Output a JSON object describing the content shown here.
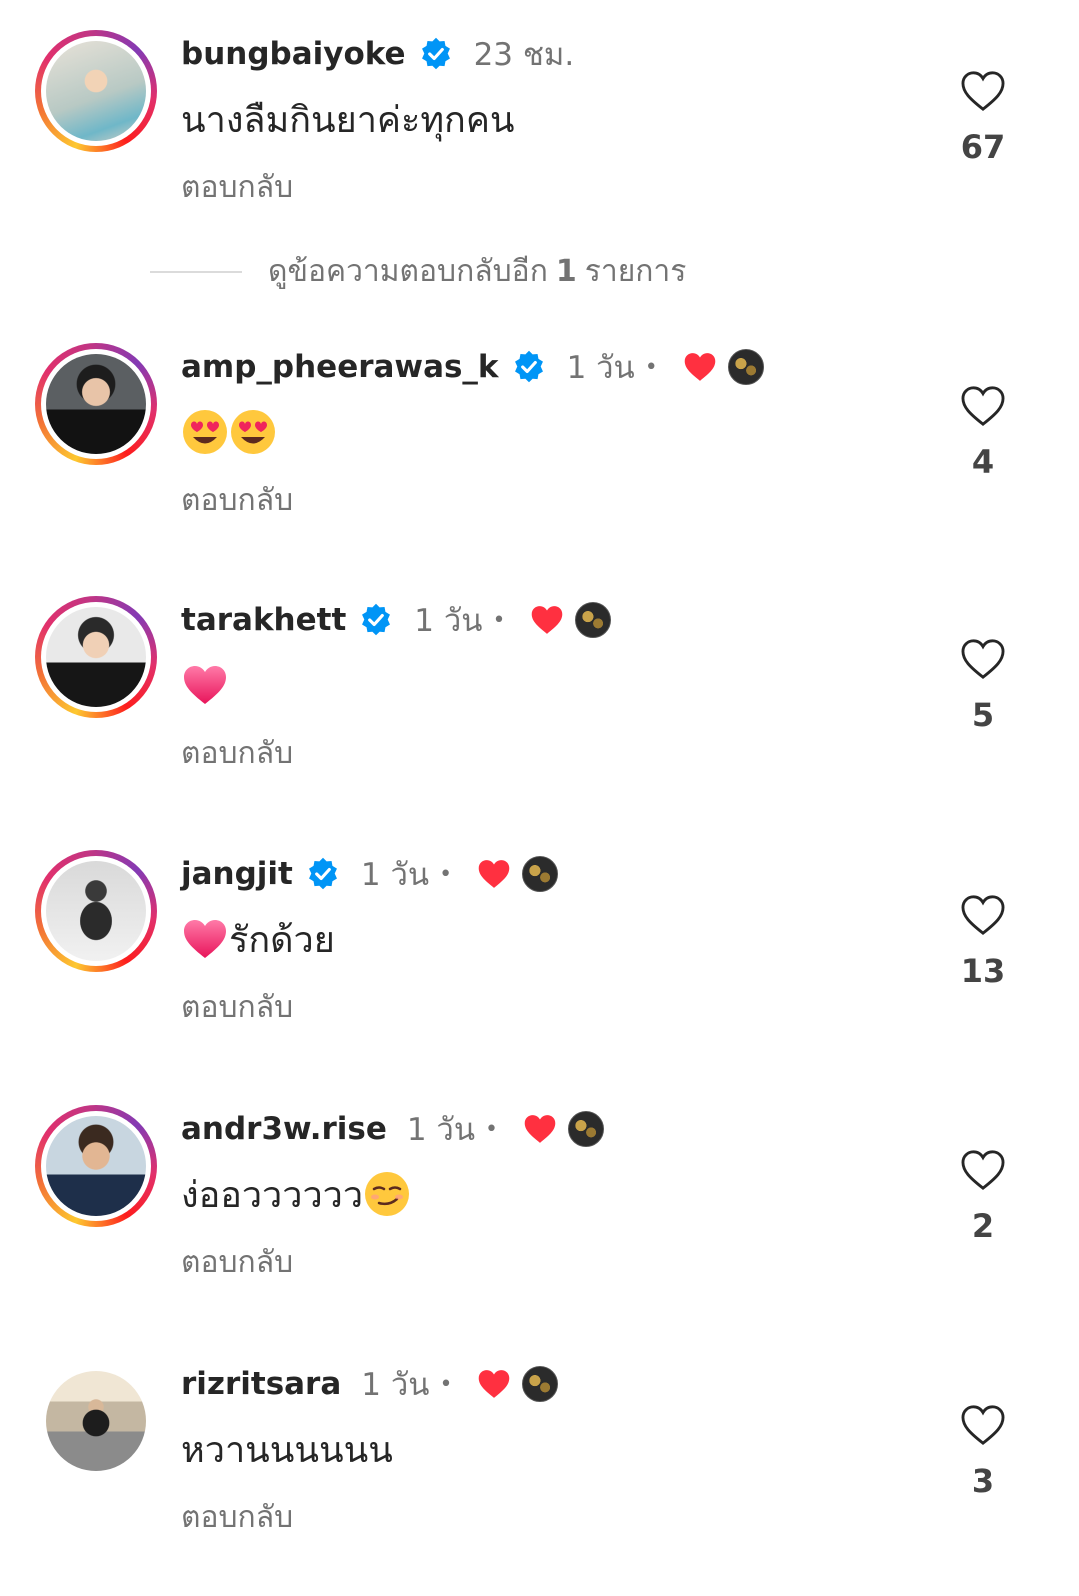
{
  "comments": [
    {
      "username": "bungbaiyoke",
      "verified": true,
      "time": "23 ชม.",
      "creator_liked": false,
      "text": "นางลืมกินยาค่ะทุกคน",
      "reply_label": "ตอบกลับ",
      "likes": "67",
      "avatar_story": true
    },
    {
      "username": "amp_pheerawas_k",
      "verified": true,
      "time": "1 วัน",
      "creator_liked": true,
      "text": "",
      "emoji": "heart-eyes-face-emoji x2",
      "reply_label": "ตอบกลับ",
      "likes": "4",
      "avatar_story": true
    },
    {
      "username": "tarakhett",
      "verified": true,
      "time": "1 วัน",
      "creator_liked": true,
      "text": "",
      "emoji": "pink-heart-emoji",
      "reply_label": "ตอบกลับ",
      "likes": "5",
      "avatar_story": true
    },
    {
      "username": "jangjit",
      "verified": true,
      "time": "1 วัน",
      "creator_liked": true,
      "text": "รักด้วย",
      "emoji": "pink-heart-emoji",
      "reply_label": "ตอบกลับ",
      "likes": "13",
      "avatar_story": true
    },
    {
      "username": "andr3w.rise",
      "verified": false,
      "time": "1 วัน",
      "creator_liked": true,
      "text": "ง่ออวววววว",
      "emoji": "smirking-face-emoji",
      "reply_label": "ตอบกลับ",
      "likes": "2",
      "avatar_story": true
    },
    {
      "username": "rizritsara",
      "verified": false,
      "time": "1 วัน",
      "creator_liked": true,
      "text": "หวานนนนนน",
      "reply_label": "ตอบกลับ",
      "likes": "3",
      "avatar_story": false
    }
  ],
  "view_replies": {
    "prefix": "ดูข้อความตอบกลับอีก",
    "count": "1",
    "suffix": "รายการ"
  },
  "dot": "•",
  "colors": {
    "verified_blue": "#0095f6",
    "like_red": "#ff3040",
    "secondary_text": "#737373"
  }
}
